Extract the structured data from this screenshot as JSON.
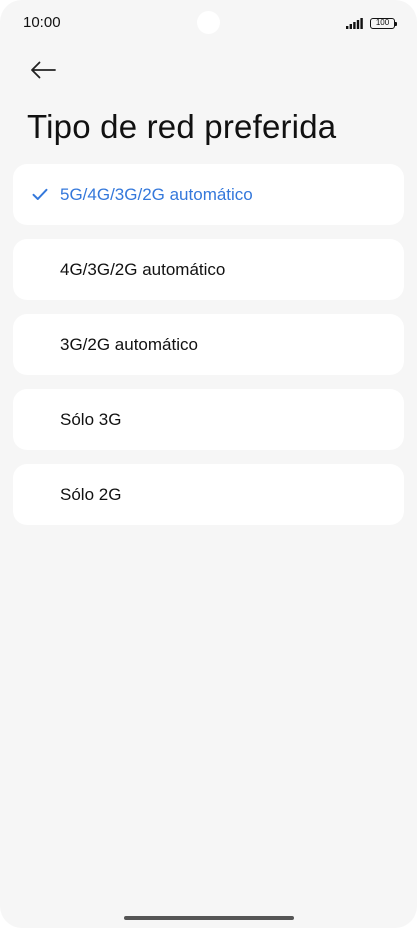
{
  "status_bar": {
    "time": "10:00",
    "battery": "100",
    "signal_icon": "signal-icon",
    "battery_icon": "battery-icon"
  },
  "header": {
    "back_icon": "arrow-left-icon",
    "title": "Tipo de red preferida"
  },
  "accent_color": "#3478db",
  "options": [
    {
      "label": "5G/4G/3G/2G automático",
      "selected": true
    },
    {
      "label": "4G/3G/2G automático",
      "selected": false
    },
    {
      "label": "3G/2G automático",
      "selected": false
    },
    {
      "label": "Sólo 3G",
      "selected": false
    },
    {
      "label": "Sólo 2G",
      "selected": false
    }
  ],
  "check_icon": "checkmark-icon"
}
